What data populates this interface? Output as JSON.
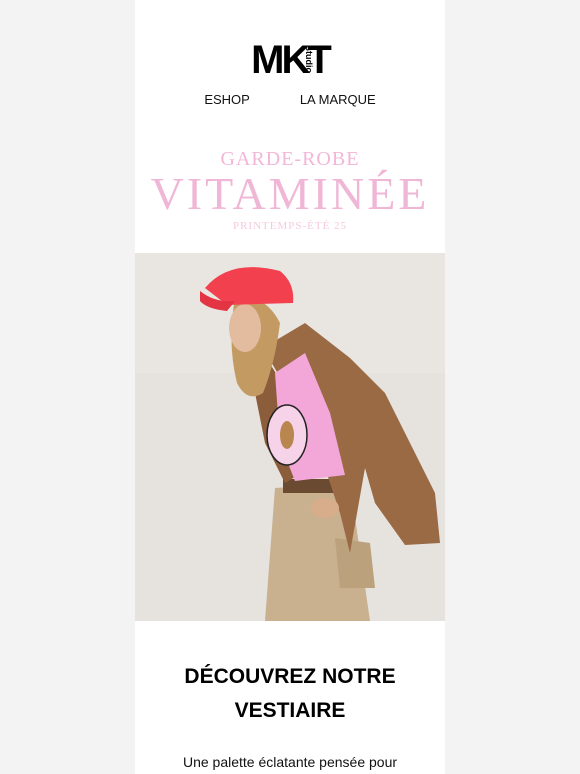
{
  "brand": {
    "logo_main": "MKT",
    "logo_sub": "studio"
  },
  "nav": {
    "items": [
      "ESHOP",
      "LA MARQUE"
    ]
  },
  "hero": {
    "kicker": "GARDE-ROBE",
    "headline": "VITAMINÉE",
    "season": "PRINTEMPS-ÉTÉ 25",
    "accent_color": "#f0b6d5"
  },
  "section": {
    "title_line1": "DÉCOUVREZ NOTRE",
    "title_line2": "VESTIAIRE",
    "body": "Une palette éclatante pensée pour"
  }
}
